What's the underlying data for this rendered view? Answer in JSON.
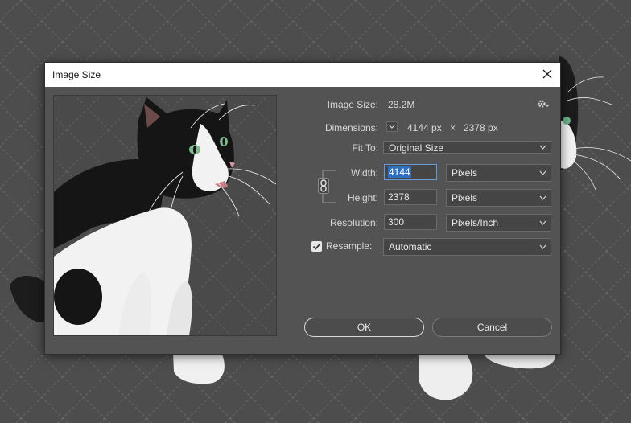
{
  "dialog": {
    "title": "Image Size"
  },
  "form": {
    "image_size_label": "Image Size:",
    "image_size_value": "28.2M",
    "dimensions_label": "Dimensions:",
    "dim_width": "4144 px",
    "dim_times": "×",
    "dim_height": "2378 px",
    "fit_to_label": "Fit To:",
    "fit_to_value": "Original Size",
    "width_label": "Width:",
    "width_value": "4144",
    "width_unit": "Pixels",
    "height_label": "Height:",
    "height_value": "2378",
    "height_unit": "Pixels",
    "resolution_label": "Resolution:",
    "resolution_value": "300",
    "resolution_unit": "Pixels/Inch",
    "resample_label": "Resample:",
    "resample_checked": true,
    "resample_value": "Automatic"
  },
  "buttons": {
    "ok": "OK",
    "cancel": "Cancel"
  },
  "icons": {
    "close": "close-icon",
    "settings": "gear-icon",
    "dimensions_toggle": "chevron-down-icon",
    "constrain": "link-icon",
    "checkbox": "checkmark-icon"
  },
  "colors": {
    "dialog_bg": "#535353",
    "canvas_bg": "#4d4d4d",
    "selection": "#2f6fc0"
  }
}
